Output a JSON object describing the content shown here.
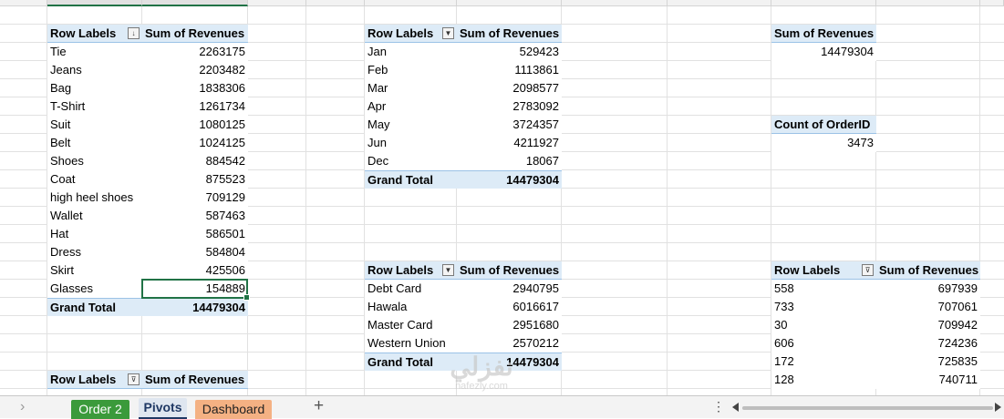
{
  "pivots": {
    "products": {
      "header": {
        "label": "Row Labels",
        "value": "Sum of Revenues"
      },
      "rows": [
        {
          "label": "Tie",
          "value": "2263175"
        },
        {
          "label": "Jeans",
          "value": "2203482"
        },
        {
          "label": "Bag",
          "value": "1838306"
        },
        {
          "label": "T-Shirt",
          "value": "1261734"
        },
        {
          "label": "Suit",
          "value": "1080125"
        },
        {
          "label": "Belt",
          "value": "1024125"
        },
        {
          "label": "Shoes",
          "value": "884542"
        },
        {
          "label": "Coat",
          "value": "875523"
        },
        {
          "label": "high heel shoes",
          "value": "709129"
        },
        {
          "label": "Wallet",
          "value": "587463"
        },
        {
          "label": "Hat",
          "value": "586501"
        },
        {
          "label": "Dress",
          "value": "584804"
        },
        {
          "label": "Skirt",
          "value": "425506"
        },
        {
          "label": "Glasses",
          "value": "154889"
        }
      ],
      "total": {
        "label": "Grand Total",
        "value": "14479304"
      }
    },
    "months": {
      "header": {
        "label": "Row Labels",
        "value": "Sum of Revenues"
      },
      "rows": [
        {
          "label": "Jan",
          "value": "529423"
        },
        {
          "label": "Feb",
          "value": "1113861"
        },
        {
          "label": "Mar",
          "value": "2098577"
        },
        {
          "label": "Apr",
          "value": "2783092"
        },
        {
          "label": "May",
          "value": "3724357"
        },
        {
          "label": "Jun",
          "value": "4211927"
        },
        {
          "label": "Dec",
          "value": "18067"
        }
      ],
      "total": {
        "label": "Grand Total",
        "value": "14479304"
      }
    },
    "sum_revenues": {
      "label": "Sum of Revenues",
      "value": "14479304"
    },
    "count_orders": {
      "label": "Count of OrderID",
      "value": "3473"
    },
    "payments": {
      "header": {
        "label": "Row Labels",
        "value": "Sum of Revenues"
      },
      "rows": [
        {
          "label": "Debt Card",
          "value": "2940795"
        },
        {
          "label": "Hawala",
          "value": "6016617"
        },
        {
          "label": "Master Card",
          "value": "2951680"
        },
        {
          "label": "Western Union",
          "value": "2570212"
        }
      ],
      "total": {
        "label": "Grand Total",
        "value": "14479304"
      }
    },
    "customers": {
      "header": {
        "label": "Row Labels",
        "value": "Sum of Revenues"
      },
      "rows": [
        {
          "label": "558",
          "value": "697939"
        },
        {
          "label": "733",
          "value": "707061"
        },
        {
          "label": "30",
          "value": "709942"
        },
        {
          "label": "606",
          "value": "724236"
        },
        {
          "label": "172",
          "value": "725835"
        },
        {
          "label": "128",
          "value": "740711"
        }
      ]
    },
    "bottom": {
      "header": {
        "label": "Row Labels",
        "value": "Sum of Revenues"
      }
    }
  },
  "tabs": {
    "order2": "Order 2",
    "pivots": "Pivots",
    "dashboard": "Dashboard"
  },
  "icons": {
    "sort": "sort-desc-icon",
    "dropdown": "dropdown-icon",
    "filter": "filter-icon",
    "add_sheet": "plus-icon"
  },
  "colors": {
    "pivot_header": "#ddebf7",
    "selection": "#217346",
    "tab_green": "#3b9a3b",
    "tab_orange": "#f4b183"
  },
  "watermark": {
    "text": "نفزلي",
    "sub": "nafezly.com"
  }
}
